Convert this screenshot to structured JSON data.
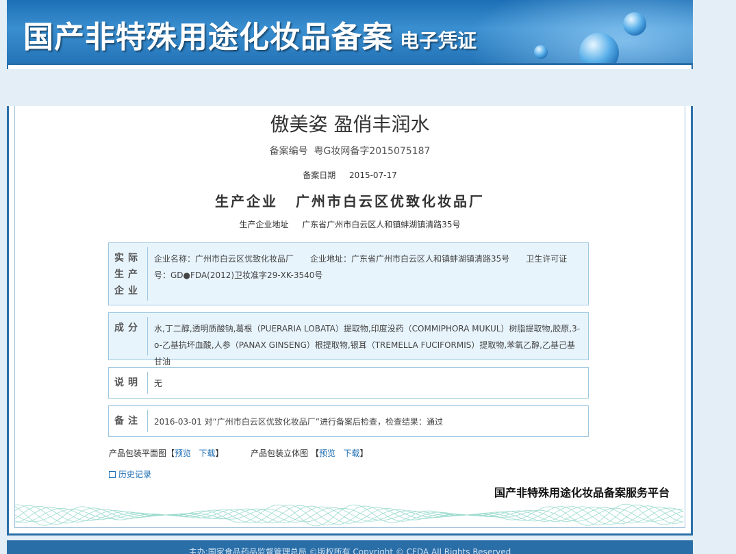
{
  "header": {
    "title": "国产非特殊用途化妆品备案",
    "subtitle": "电子凭证"
  },
  "product": {
    "name": "傲美姿 盈俏丰润水",
    "filing_number_label": "备案编号",
    "filing_number": "粤G妆网备字2015075187",
    "filing_date_label": "备案日期",
    "filing_date": "2015-07-17",
    "manufacturer_label": "生产企业",
    "manufacturer": "广州市白云区优致化妆品厂",
    "manufacturer_address_label": "生产企业地址",
    "manufacturer_address": "广东省广州市白云区人和镇蚌湖镇清路35号"
  },
  "sections": {
    "actual_producer": {
      "label_lines": [
        "实际",
        "生产",
        "企业"
      ],
      "text": "企业名称：广州市白云区优致化妆品厂　　企业地址：广东省广州市白云区人和镇蚌湖镇清路35号　　卫生许可证号：GD●FDA(2012)卫妆准字29-XK-3540号"
    },
    "ingredients": {
      "label": "成分",
      "text": "水,丁二醇,透明质酸钠,葛根（PUERARIA LOBATA）提取物,印度没药（COMMIPHORA MUKUL）树脂提取物,胶原,3-o-乙基抗坏血酸,人参（PANAX GINSENG）根提取物,银耳（TREMELLA FUCIFORMIS）提取物,苯氧乙醇,乙基己基甘油"
    },
    "description": {
      "label": "说明",
      "text": "无"
    },
    "remarks": {
      "label": "备注",
      "text": "2016-03-01 对“广州市白云区优致化妆品厂”进行备案后检查，检查结果：通过"
    }
  },
  "links": {
    "flat_label": "产品包装平面图【",
    "preview": "预览",
    "download": "下载",
    "close_bracket": "】",
    "stereo_label": "产品包装立体图 【",
    "history": "历史记录"
  },
  "platform_name": "国产非特殊用途化妆品备案服务平台",
  "footer": {
    "text": "主办:国家食品药品监督管理总局 ©版权所有 Copyright © CFDA All Rights Reserved"
  }
}
